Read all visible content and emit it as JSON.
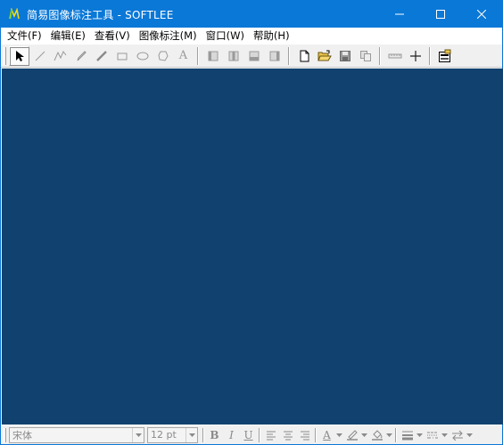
{
  "window": {
    "title": "简易图像标注工具 - SOFTLEE",
    "app_icon_glyph": "N"
  },
  "menu": [
    {
      "label": "文件(F)"
    },
    {
      "label": "编辑(E)"
    },
    {
      "label": "查看(V)"
    },
    {
      "label": "图像标注(M)"
    },
    {
      "label": "窗口(W)"
    },
    {
      "label": "帮助(H)"
    }
  ],
  "toolbar": {
    "draw_tools": [
      "select-arrow-icon",
      "line-icon",
      "polyline-icon",
      "pencil-icon",
      "brush-icon",
      "rectangle-icon",
      "ellipse-icon",
      "polygon-icon",
      "text-tool-icon"
    ],
    "active_tool": "select-arrow-icon",
    "align_tools": [
      "align-left-icon",
      "align-center-icon",
      "align-bottom-icon",
      "align-right-icon"
    ],
    "file_tools": [
      "new-file-icon",
      "open-folder-icon",
      "save-icon",
      "copy-icon"
    ],
    "extra_tools": [
      "ruler-icon",
      "crosshair-icon",
      "properties-icon"
    ],
    "text_tool_glyph": "A"
  },
  "format_bar": {
    "font_name": "宋体",
    "font_size": "12 pt",
    "bold": "B",
    "italic": "I",
    "underline": "U",
    "font_color_glyph": "A"
  },
  "colors": {
    "titlebar": "#0a78d7",
    "canvas": "#11426f",
    "chrome": "#f0f0f0"
  }
}
